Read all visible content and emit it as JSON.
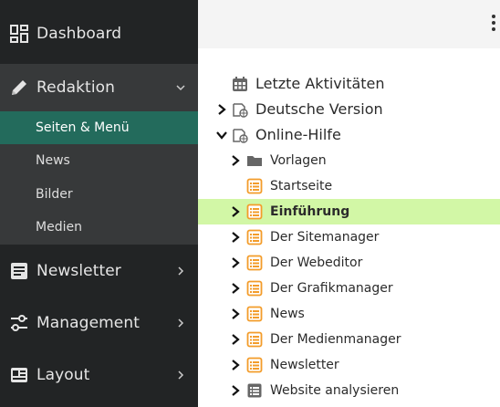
{
  "sidebar": {
    "dashboard": "Dashboard",
    "redaktion": "Redaktion",
    "sub": [
      "Seiten & Menü",
      "News",
      "Bilder",
      "Medien"
    ],
    "newsletter": "Newsletter",
    "management": "Management",
    "layout": "Layout"
  },
  "tree": {
    "recent": "Letzte Aktivitäten",
    "deutsche": "Deutsche Version",
    "online": "Online-Hilfe",
    "items": [
      "Vorlagen",
      "Startseite",
      "Einführung",
      "Der Sitemanager",
      "Der Webeditor",
      "Der Grafikmanager",
      "News",
      "Der Medienmanager",
      "Newsletter",
      "Website analysieren"
    ]
  },
  "colors": {
    "sidebar_bg": "#222425",
    "active_item": "#236b5c",
    "highlight_row": "#d2f7a6",
    "page_icon": "#f39c2a"
  }
}
